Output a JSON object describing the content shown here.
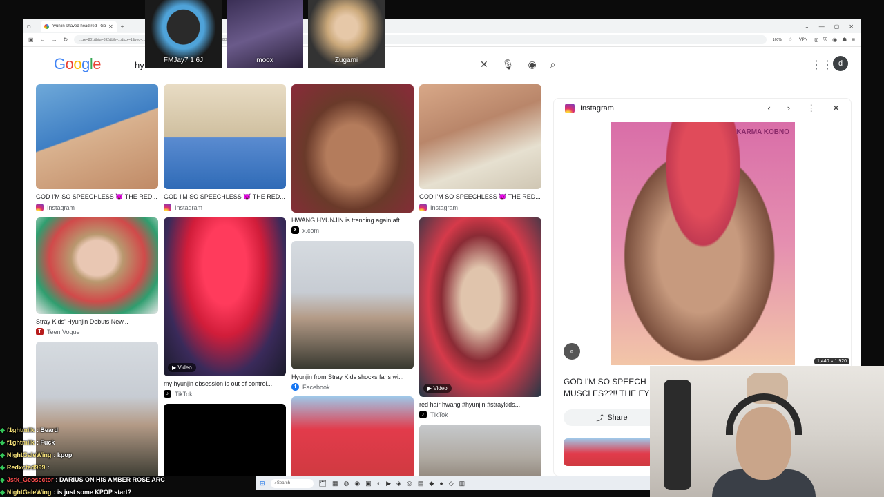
{
  "browser": {
    "tab_title": "hyunjin shaved head red - Goo...",
    "url": "...ze=801&biw=692&bih=...&ictx=1&ved=...TZ1A1786222049734&ei=zZd3as1LOa0qfsP1MfK0Qk&oe=0ahUKEwiIoqyU9ZGWAxVm...",
    "zoom": "160%",
    "vpn": "VPN"
  },
  "google": {
    "logo": [
      "G",
      "o",
      "o",
      "g",
      "l",
      "e"
    ],
    "search_text": "hy",
    "search_suffix": "d",
    "avatar_letter": "d"
  },
  "results": [
    {
      "caption": "",
      "source": "",
      "video": false
    },
    {
      "caption": "",
      "source": "",
      "video": false
    },
    {
      "caption": "",
      "source": "",
      "video": false
    },
    {
      "caption": "",
      "source": "",
      "video": false
    },
    {
      "caption": "GOD I'M SO SPEECHLESS 😈 THE RED...",
      "source": "Instagram",
      "video": false
    },
    {
      "caption": "GOD I'M SO SPEECHLESS 😈 THE RED...",
      "source": "Instagram",
      "video": false
    },
    {
      "caption": "HWANG HYUNJIN is trending again aft...",
      "source": "x.com",
      "video": false
    },
    {
      "caption": "GOD I'M SO SPEECHLESS 😈 THE RED...",
      "source": "Instagram",
      "video": false
    },
    {
      "caption": "Stray Kids' Hyunjin Debuts New...",
      "source": "Teen Vogue",
      "video": false
    },
    {
      "caption": "my hyunjin obsession is out of control...",
      "source": "TikTok",
      "video": true,
      "video_label": "Video"
    },
    {
      "caption": "Hyunjin from Stray Kids shocks fans wi...",
      "source": "Facebook",
      "video": false
    },
    {
      "caption": "red hair hwang #hyunjin #straykids...",
      "source": "TikTok",
      "video": true,
      "video_label": "Video"
    }
  ],
  "panel": {
    "source": "Instagram",
    "brand_text": "KARMA KOBNO",
    "dims": "1,440 × 1,920",
    "title_line1": "GOD I'M SO SPEECH",
    "title_line2": "MUSCLES??!! THE EY",
    "share_label": "Share"
  },
  "stream": {
    "avatars": [
      "FMJay7 1 6J",
      "moox",
      "Zugami"
    ],
    "chat": [
      {
        "user": "f1ghtmilk",
        "msg": ": Beard",
        "red": false
      },
      {
        "user": "f1ghtmilk",
        "msg": ": Fuck",
        "red": false
      },
      {
        "user": "NightGaleWing",
        "msg": ": kpop",
        "red": false
      },
      {
        "user": "Redxcted999",
        "msg": ":",
        "red": false
      },
      {
        "user": "Jstk_Geosector",
        "msg": ": DARIUS ON HIS AMBER ROSE ARC",
        "red": true
      },
      {
        "user": "NightGaleWing",
        "msg": ": is just some KPOP start?",
        "red": false
      }
    ],
    "taskbar_search": "Search"
  },
  "colors": {
    "google_blue": "#4285f4",
    "google_red": "#ea4335",
    "google_yellow": "#fbbc05",
    "google_green": "#34a853"
  }
}
